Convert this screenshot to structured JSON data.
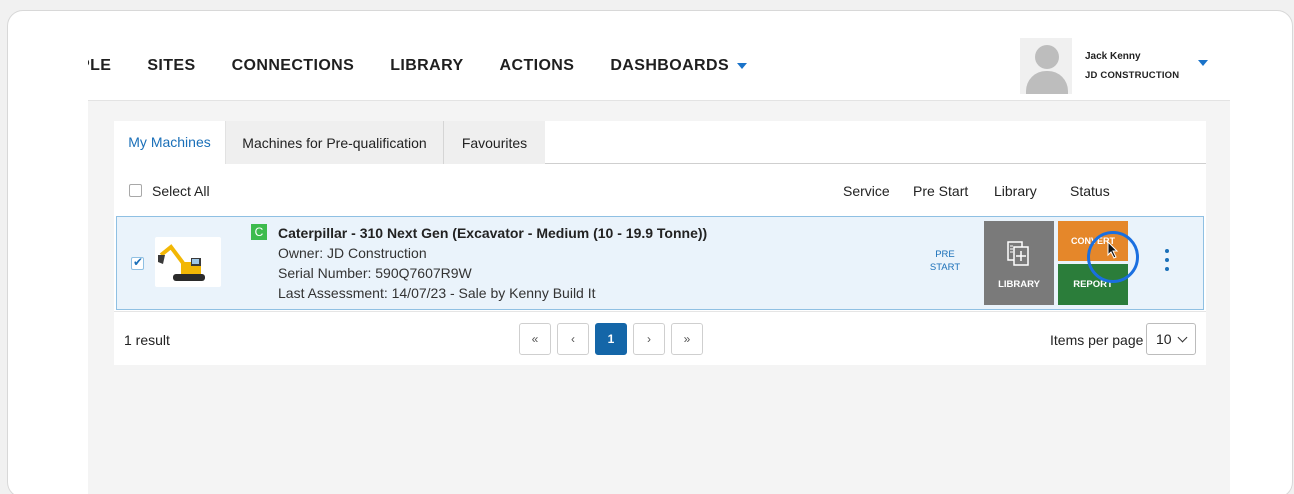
{
  "nav": {
    "items": [
      {
        "label": "PLE"
      },
      {
        "label": "SITES"
      },
      {
        "label": "CONNECTIONS"
      },
      {
        "label": "LIBRARY"
      },
      {
        "label": "ACTIONS"
      },
      {
        "label": "DASHBOARDS"
      }
    ]
  },
  "user": {
    "name": "Jack Kenny",
    "company": "JD CONSTRUCTION"
  },
  "tabs": [
    {
      "label": "My Machines",
      "active": true
    },
    {
      "label": "Machines for Pre-qualification",
      "active": false
    },
    {
      "label": "Favourites",
      "active": false
    }
  ],
  "table": {
    "select_all": "Select All",
    "columns": [
      "Service",
      "Pre Start",
      "Library",
      "Status"
    ],
    "rows": [
      {
        "checked": true,
        "category_badge": "C",
        "title": "Caterpillar - 310 Next Gen (Excavator - Medium (10 - 19.9 Tonne))",
        "owner": "Owner: JD Construction",
        "serial": "Serial Number: 590Q7607R9W",
        "last_assessment": "Last Assessment: 14/07/23 - Sale by Kenny Build It",
        "prestart_line1": "PRE",
        "prestart_line2": "START",
        "library_label": "LIBRARY",
        "convert_label": "CONVERT",
        "report_label": "REPORT"
      }
    ]
  },
  "footer": {
    "result_count": "1 result",
    "pagination": {
      "first": "«",
      "prev": "‹",
      "current": "1",
      "next": "›",
      "last": "»"
    },
    "items_per_page_label": "Items per page",
    "items_per_page_value": "10"
  },
  "colors": {
    "accent": "#1a6fb8",
    "convert": "#e5872a",
    "report": "#2b7d3a",
    "library": "#7a7a7a",
    "badge": "#3dbb4d"
  }
}
